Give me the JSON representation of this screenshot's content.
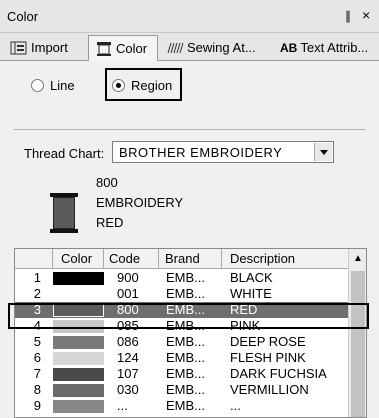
{
  "window": {
    "title": "Color",
    "pin_glyph": "∥",
    "close_glyph": "×"
  },
  "tabs": [
    {
      "label": "Import",
      "icon": "import-icon"
    },
    {
      "label": "Color",
      "icon": "color-icon"
    },
    {
      "label": "Sewing At...",
      "icon": "sewing-icon"
    },
    {
      "label": "Text Attrib...",
      "icon": "text-ab-icon",
      "icon_text": "AB"
    }
  ],
  "mode": {
    "line_label": "Line",
    "region_label": "Region",
    "selected": "Region"
  },
  "thread_chart": {
    "label": "Thread Chart:",
    "value": "BROTHER EMBROIDERY"
  },
  "current_thread": {
    "code": "800",
    "brand": "EMBROIDERY",
    "name": "RED",
    "swatch": "#5a5a5a"
  },
  "table": {
    "headers": [
      "Color",
      "Code",
      "Brand",
      "Description"
    ],
    "rows": [
      {
        "num": "1",
        "color": "#000000",
        "code": "900",
        "brand": "EMB...",
        "desc": "BLACK"
      },
      {
        "num": "2",
        "color": "#ffffff",
        "code": "001",
        "brand": "EMB...",
        "desc": "WHITE"
      },
      {
        "num": "3",
        "color": "#5c5c5c",
        "code": "800",
        "brand": "EMB...",
        "desc": "RED",
        "selected": true
      },
      {
        "num": "4",
        "color": "#c8c8c8",
        "code": "085",
        "brand": "EMB...",
        "desc": "PINK"
      },
      {
        "num": "5",
        "color": "#7a7a7a",
        "code": "086",
        "brand": "EMB...",
        "desc": "DEEP ROSE"
      },
      {
        "num": "6",
        "color": "#d6d6d6",
        "code": "124",
        "brand": "EMB...",
        "desc": "FLESH PINK"
      },
      {
        "num": "7",
        "color": "#4a4a4a",
        "code": "107",
        "brand": "EMB...",
        "desc": "DARK FUCHSIA"
      },
      {
        "num": "8",
        "color": "#6a6a6a",
        "code": "030",
        "brand": "EMB...",
        "desc": "VERMILLION"
      },
      {
        "num": "9",
        "color": "#888888",
        "code": "...",
        "brand": "EMB...",
        "desc": "..."
      }
    ]
  }
}
